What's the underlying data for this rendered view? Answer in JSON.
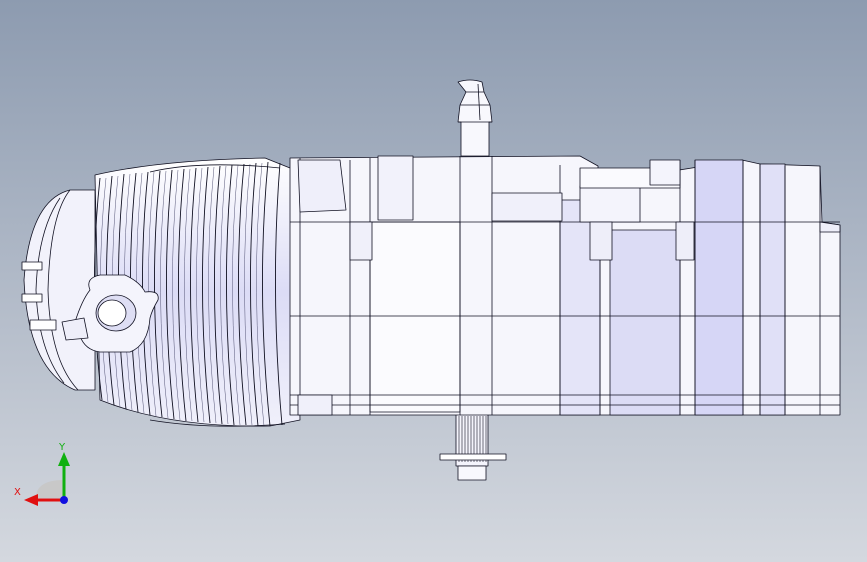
{
  "viewport": {
    "background_top": "#8d9bb0",
    "background_bottom": "#d4d8df"
  },
  "model": {
    "fill": "#f6f6fc",
    "shade": "#d2d2f4",
    "mid": "#e6e6f8",
    "line": "#111122"
  },
  "triad": {
    "x_label": "X",
    "y_label": "Y",
    "x_color": "#e01010",
    "y_color": "#10b010",
    "z_color": "#1010e0"
  }
}
